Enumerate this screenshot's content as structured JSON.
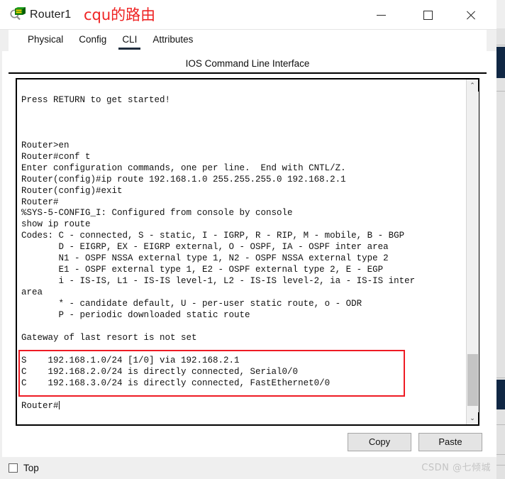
{
  "window": {
    "title": "Router1",
    "icon": "packet-tracer-router-icon",
    "annotation": "cqu的路由",
    "annotation_color": "#ef2323",
    "controls": {
      "minimize": "—",
      "maximize": "□",
      "close": "✕"
    }
  },
  "tabs": [
    {
      "label": "Physical",
      "active": false
    },
    {
      "label": "Config",
      "active": false
    },
    {
      "label": "CLI",
      "active": true
    },
    {
      "label": "Attributes",
      "active": false
    }
  ],
  "panel": {
    "heading": "IOS Command Line Interface"
  },
  "terminal": {
    "lines": [
      "",
      "Press RETURN to get started!",
      "",
      "",
      "",
      "Router>en",
      "Router#conf t",
      "Enter configuration commands, one per line.  End with CNTL/Z.",
      "Router(config)#ip route 192.168.1.0 255.255.255.0 192.168.2.1",
      "Router(config)#exit",
      "Router#",
      "%SYS-5-CONFIG_I: Configured from console by console",
      "show ip route",
      "Codes: C - connected, S - static, I - IGRP, R - RIP, M - mobile, B - BGP",
      "       D - EIGRP, EX - EIGRP external, O - OSPF, IA - OSPF inter area",
      "       N1 - OSPF NSSA external type 1, N2 - OSPF NSSA external type 2",
      "       E1 - OSPF external type 1, E2 - OSPF external type 2, E - EGP",
      "       i - IS-IS, L1 - IS-IS level-1, L2 - IS-IS level-2, ia - IS-IS inter",
      "area",
      "       * - candidate default, U - per-user static route, o - ODR",
      "       P - periodic downloaded static route",
      "",
      "Gateway of last resort is not set",
      "",
      "S    192.168.1.0/24 [1/0] via 192.168.2.1",
      "C    192.168.2.0/24 is directly connected, Serial0/0",
      "C    192.168.3.0/24 is directly connected, FastEthernet0/0",
      ""
    ],
    "prompt": "Router#",
    "highlight_color": "#ee1b24",
    "scrollbar": {
      "up_arrow": "⌃",
      "down_arrow": "⌄"
    }
  },
  "buttons": {
    "copy": "Copy",
    "paste": "Paste"
  },
  "bottom": {
    "top_checkbox_label": "Top",
    "top_checked": false
  },
  "watermark": "CSDN @七倾城"
}
